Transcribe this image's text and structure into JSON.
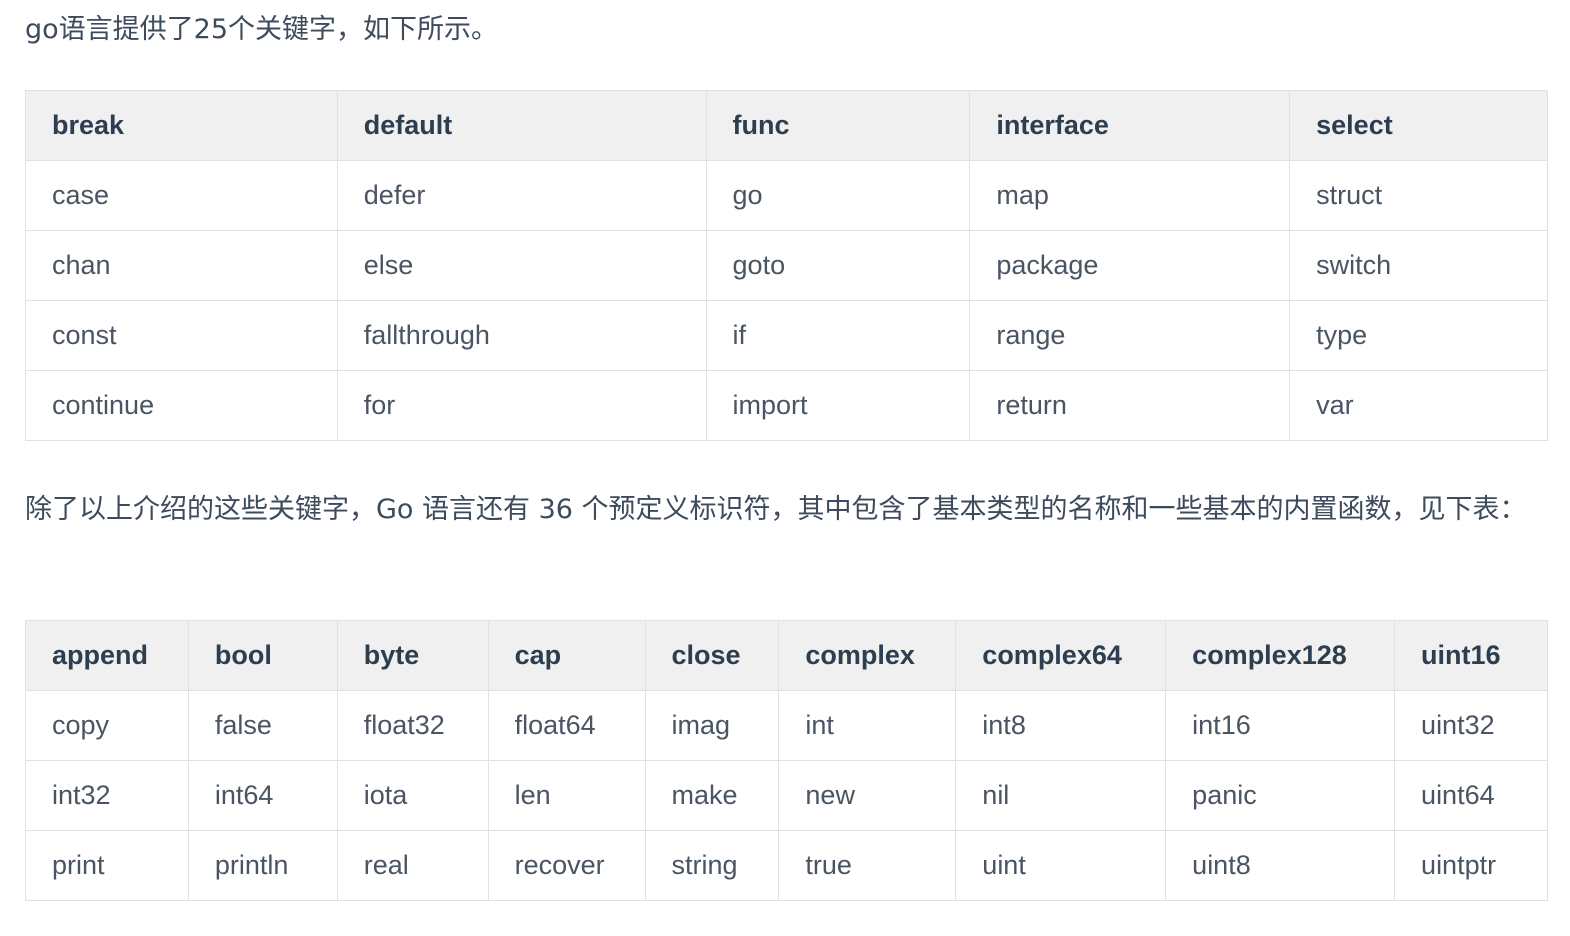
{
  "intro_text": "go语言提供了25个关键字，如下所示。",
  "keywords_table": {
    "headers": [
      "break",
      "default",
      "func",
      "interface",
      "select"
    ],
    "rows": [
      [
        "case",
        "defer",
        "go",
        "map",
        "struct"
      ],
      [
        "chan",
        "else",
        "goto",
        "package",
        "switch"
      ],
      [
        "const",
        "fallthrough",
        "if",
        "range",
        "type"
      ],
      [
        "continue",
        "for",
        "import",
        "return",
        "var"
      ]
    ]
  },
  "identifiers_text": "除了以上介绍的这些关键字，Go 语言还有 36 个预定义标识符，其中包含了基本类型的名称和一些基本的内置函数，见下表：",
  "identifiers_table": {
    "headers": [
      "append",
      "bool",
      "byte",
      "cap",
      "close",
      "complex",
      "complex64",
      "complex128",
      "uint16"
    ],
    "rows": [
      [
        "copy",
        "false",
        "float32",
        "float64",
        "imag",
        "int",
        "int8",
        "int16",
        "uint32"
      ],
      [
        "int32",
        "int64",
        "iota",
        "len",
        "make",
        "new",
        "nil",
        "panic",
        "uint64"
      ],
      [
        "print",
        "println",
        "real",
        "recover",
        "string",
        "true",
        "uint",
        "uint8",
        "uintptr"
      ]
    ]
  }
}
